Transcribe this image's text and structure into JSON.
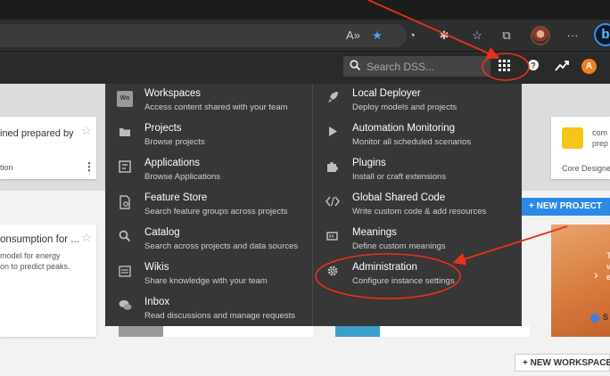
{
  "search": {
    "placeholder": "Search DSS..."
  },
  "user": {
    "initial": "A"
  },
  "menu": {
    "left": [
      {
        "id": "workspaces",
        "title": "Workspaces",
        "subtitle": "Access content shared with your team",
        "icon": "workspaces-icon"
      },
      {
        "id": "projects",
        "title": "Projects",
        "subtitle": "Browse projects",
        "icon": "folder-icon"
      },
      {
        "id": "applications",
        "title": "Applications",
        "subtitle": "Browse Applications",
        "icon": "applications-icon"
      },
      {
        "id": "feature-store",
        "title": "Feature Store",
        "subtitle": "Search feature groups across projects",
        "icon": "feature-store-icon"
      },
      {
        "id": "catalog",
        "title": "Catalog",
        "subtitle": "Search across projects and data sources",
        "icon": "search-icon"
      },
      {
        "id": "wikis",
        "title": "Wikis",
        "subtitle": "Share knowledge with your team",
        "icon": "wiki-icon"
      },
      {
        "id": "inbox",
        "title": "Inbox",
        "subtitle": "Read discussions and manage requests",
        "icon": "chat-icon"
      }
    ],
    "right": [
      {
        "id": "local-deployer",
        "title": "Local Deployer",
        "subtitle": "Deploy models and projects",
        "icon": "rocket-icon"
      },
      {
        "id": "automation-monitoring",
        "title": "Automation Monitoring",
        "subtitle": "Monitor all scheduled scenarios",
        "icon": "play-icon"
      },
      {
        "id": "plugins",
        "title": "Plugins",
        "subtitle": "Install or craft extensions",
        "icon": "puzzle-icon"
      },
      {
        "id": "global-shared-code",
        "title": "Global Shared Code",
        "subtitle": "Write custom code & add resources",
        "icon": "code-icon"
      },
      {
        "id": "meanings",
        "title": "Meanings",
        "subtitle": "Define custom meanings",
        "icon": "meanings-icon"
      },
      {
        "id": "administration",
        "title": "Administration",
        "subtitle": "Configure instance settings",
        "icon": "gear-icon"
      }
    ]
  },
  "background": {
    "card1_text": "ined prepared by",
    "card1_sub": "tion",
    "card2_title": "onsumption for ...",
    "card2_line1": "model for energy",
    "card2_line2": "on to predict peaks.",
    "card3_line1": "com",
    "card3_line2": "prep",
    "card3_sub": "Core Designe",
    "orange_letter1": "T",
    "orange_letter2": "v",
    "orange_letter3": "e",
    "orange_letter4": "S"
  },
  "buttons": {
    "new_project": "+ NEW PROJECT",
    "new_workspace": "+ NEW WORKSPACE"
  },
  "colors": {
    "annotation": "#e8321e",
    "primary": "#2b8ae6",
    "avatar": "#f0821f"
  }
}
